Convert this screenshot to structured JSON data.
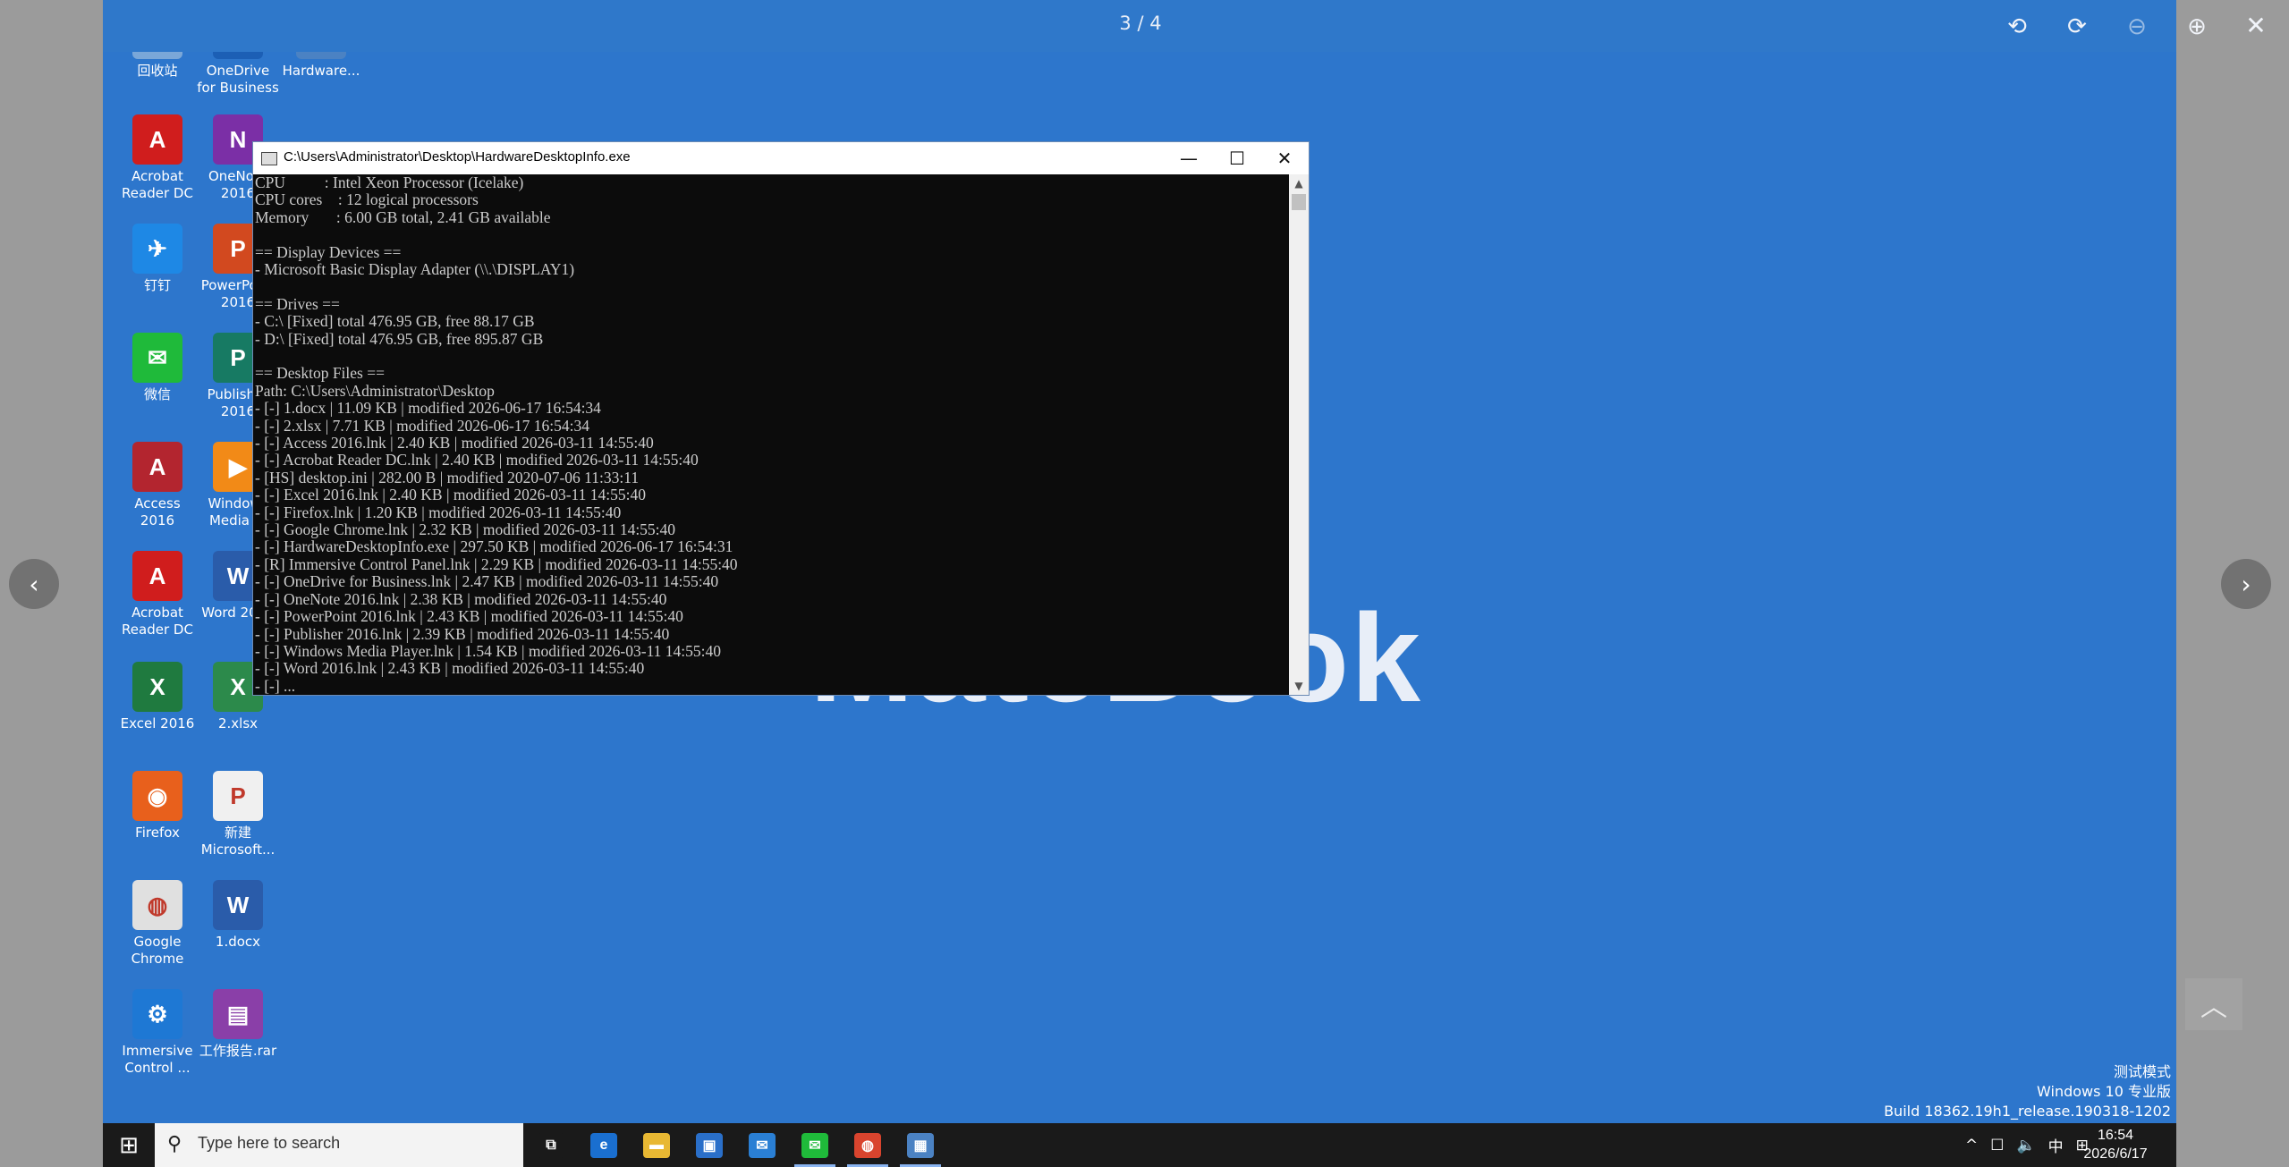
{
  "viewer": {
    "counter": "3 / 4",
    "tools": [
      "rotate-left-icon",
      "rotate-right-icon",
      "zoom-out-icon",
      "zoom-in-icon",
      "close-icon"
    ],
    "prev_arrow": "‹",
    "next_arrow": "›",
    "scroll_top": "︿"
  },
  "desktop": {
    "background_text": "MateBook",
    "icons": [
      {
        "label": "回收站",
        "color": "#7aa7d8",
        "glyph": "♻"
      },
      {
        "label": "OneDrive for Business",
        "color": "#1c5fb5",
        "glyph": "☁"
      },
      {
        "label": "Hardware...",
        "color": "#4b82c3",
        "glyph": "▦"
      },
      {
        "label": "Acrobat Reader DC",
        "color": "#d01d1d",
        "glyph": "A"
      },
      {
        "label": "OneNote 2016",
        "color": "#7b2fa6",
        "glyph": "N"
      },
      {
        "label": "钉钉",
        "color": "#1e88e5",
        "glyph": "✈"
      },
      {
        "label": "PowerPoint 2016",
        "color": "#d2491f",
        "glyph": "P"
      },
      {
        "label": "微信",
        "color": "#1fba3a",
        "glyph": "✉"
      },
      {
        "label": "Publisher 2016",
        "color": "#177a63",
        "glyph": "P"
      },
      {
        "label": "Access 2016",
        "color": "#b3252f",
        "glyph": "A"
      },
      {
        "label": "Windows Media ...",
        "color": "#f28a17",
        "glyph": "▶"
      },
      {
        "label": "Acrobat Reader DC",
        "color": "#d01d1d",
        "glyph": "A"
      },
      {
        "label": "Word 2016",
        "color": "#2a5caa",
        "glyph": "W"
      },
      {
        "label": "Excel 2016",
        "color": "#1f7a3f",
        "glyph": "X"
      },
      {
        "label": "2.xlsx",
        "color": "#2c8a4b",
        "glyph": "X"
      },
      {
        "label": "Firefox",
        "color": "#e8601c",
        "glyph": "◉"
      },
      {
        "label": "新建 Microsoft...",
        "color": "#f0f0f0",
        "glyph": "P"
      },
      {
        "label": "Google Chrome",
        "color": "#e0e0e0",
        "glyph": "◍"
      },
      {
        "label": "1.docx",
        "color": "#2a5caa",
        "glyph": "W"
      },
      {
        "label": "Immersive Control ...",
        "color": "#1e78d4",
        "glyph": "⚙"
      },
      {
        "label": "工作报告.rar",
        "color": "#8a3fa8",
        "glyph": "▤"
      }
    ],
    "watermark": [
      "测试模式",
      "Windows 10 专业版",
      "Build 18362.19h1_release.190318-1202"
    ]
  },
  "console": {
    "title": "C:\\Users\\Administrator\\Desktop\\HardwareDesktopInfo.exe",
    "minimize": "—",
    "maximize": "☐",
    "close": "✕",
    "lines": [
      "CPU          : Intel Xeon Processor (Icelake)",
      "CPU cores    : 12 logical processors",
      "Memory       : 6.00 GB total, 2.41 GB available",
      "",
      "== Display Devices ==",
      "- Microsoft Basic Display Adapter (\\\\.\\DISPLAY1)",
      "",
      "== Drives ==",
      "- C:\\ [Fixed] total 476.95 GB, free 88.17 GB",
      "- D:\\ [Fixed] total 476.95 GB, free 895.87 GB",
      "",
      "== Desktop Files ==",
      "Path: C:\\Users\\Administrator\\Desktop",
      "- [-] 1.docx | 11.09 KB | modified 2026-06-17 16:54:34",
      "- [-] 2.xlsx | 7.71 KB | modified 2026-06-17 16:54:34",
      "- [-] Access 2016.lnk | 2.40 KB | modified 2026-03-11 14:55:40",
      "- [-] Acrobat Reader DC.lnk | 2.40 KB | modified 2026-03-11 14:55:40",
      "- [HS] desktop.ini | 282.00 B | modified 2020-07-06 11:33:11",
      "- [-] Excel 2016.lnk | 2.40 KB | modified 2026-03-11 14:55:40",
      "- [-] Firefox.lnk | 1.20 KB | modified 2026-03-11 14:55:40",
      "- [-] Google Chrome.lnk | 2.32 KB | modified 2026-03-11 14:55:40",
      "- [-] HardwareDesktopInfo.exe | 297.50 KB | modified 2026-06-17 16:54:31",
      "- [R] Immersive Control Panel.lnk | 2.29 KB | modified 2026-03-11 14:55:40",
      "- [-] OneDrive for Business.lnk | 2.47 KB | modified 2026-03-11 14:55:40",
      "- [-] OneNote 2016.lnk | 2.38 KB | modified 2026-03-11 14:55:40",
      "- [-] PowerPoint 2016.lnk | 2.43 KB | modified 2026-03-11 14:55:40",
      "- [-] Publisher 2016.lnk | 2.39 KB | modified 2026-03-11 14:55:40",
      "- [-] Windows Media Player.lnk | 1.54 KB | modified 2026-03-11 14:55:40",
      "- [-] Word 2016.lnk | 2.43 KB | modified 2026-03-11 14:55:40",
      "- [-] ..."
    ]
  },
  "taskbar": {
    "search_placeholder": "Type here to search",
    "apps": [
      {
        "name": "task-view",
        "glyph": "⧉",
        "color": "#1a1a1a",
        "running": false
      },
      {
        "name": "edge",
        "glyph": "e",
        "color": "#1a6fd0",
        "running": false
      },
      {
        "name": "file-explorer",
        "glyph": "▬",
        "color": "#e8b833",
        "running": false
      },
      {
        "name": "store",
        "glyph": "▣",
        "color": "#2a6fc9",
        "running": false
      },
      {
        "name": "mail",
        "glyph": "✉",
        "color": "#2a7fd4",
        "running": false
      },
      {
        "name": "wechat",
        "glyph": "✉",
        "color": "#1fba3a",
        "running": true
      },
      {
        "name": "chrome",
        "glyph": "◍",
        "color": "#d9442e",
        "running": true
      },
      {
        "name": "hardware-info",
        "glyph": "▦",
        "color": "#4b82c3",
        "running": true
      }
    ],
    "tray": [
      "^",
      "☐",
      "🔈",
      "中",
      "⊞"
    ],
    "time": "16:54",
    "date": "2026/6/17"
  }
}
